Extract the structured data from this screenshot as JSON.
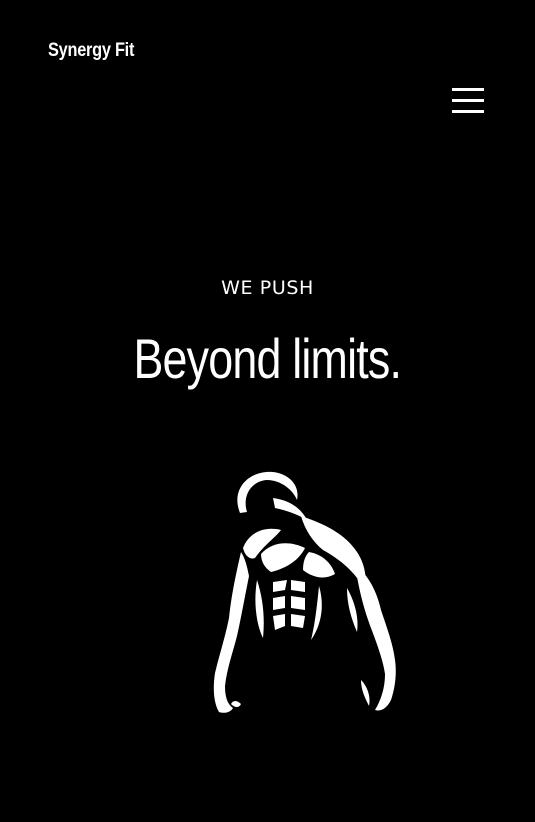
{
  "header": {
    "brand": "Synergy Fit",
    "menu_icon": "hamburger-menu-icon"
  },
  "hero": {
    "kicker": "WE PUSH",
    "headline": "Beyond limits.",
    "figure_icon": "athlete-silhouette-icon"
  },
  "colors": {
    "background": "#000000",
    "text": "#ffffff"
  }
}
